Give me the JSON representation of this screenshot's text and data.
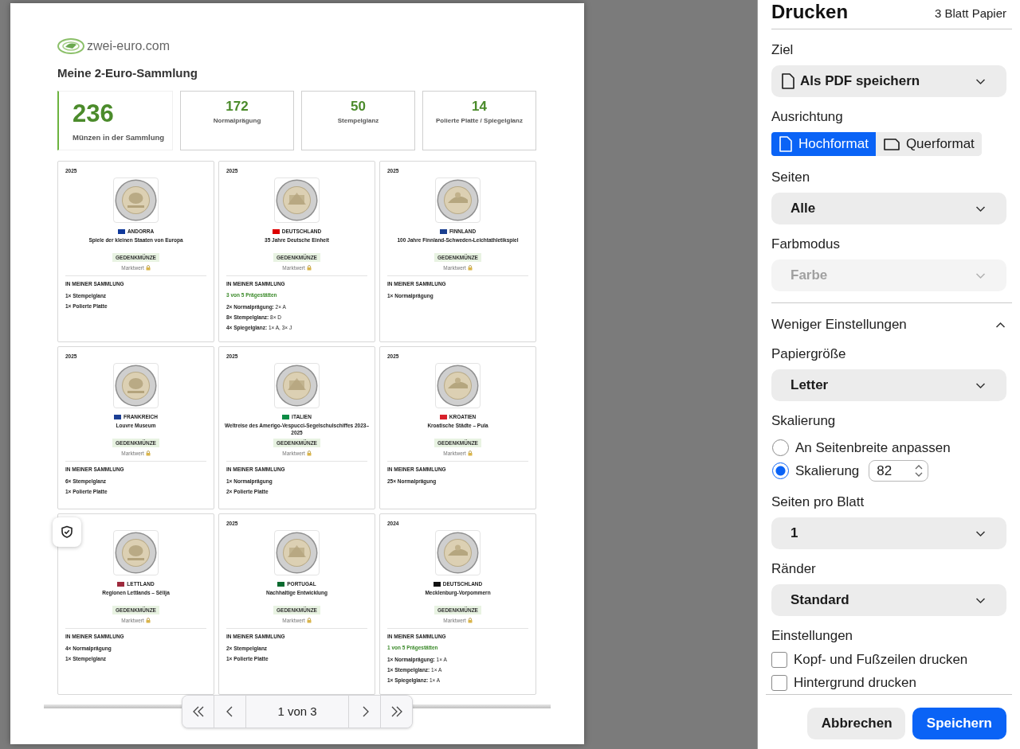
{
  "preview": {
    "logo_text": "zwei-euro.com",
    "heading": "Meine 2-Euro-Sammlung",
    "stats": [
      {
        "value": "236",
        "label": "Münzen in der Sammlung",
        "highlighted": true
      },
      {
        "value": "172",
        "label": "Normalprägung",
        "highlighted": false
      },
      {
        "value": "50",
        "label": "Stempelglanz",
        "highlighted": false
      },
      {
        "value": "14",
        "label": "Polierte Platte / Spiegelglanz",
        "highlighted": false
      }
    ],
    "coin_rows": [
      [
        {
          "year": "2025",
          "country": "ANDORRA",
          "color": "#10399b",
          "title": "Spiele der kleinen Staaten von Europa",
          "tag": "GEDENKMÜNZE",
          "price_label": "Marktwert",
          "section": "IN MEINER SAMMLUNG",
          "entries": [
            {
              "label": "1× Stempelglanz"
            },
            {
              "label": "1× Polierte Platte"
            }
          ]
        },
        {
          "year": "2025",
          "country": "DEUTSCHLAND",
          "color": "#dd0000",
          "title": "35 Jahre Deutsche Einheit",
          "tag": "GEDENKMÜNZE",
          "price_label": "Marktwert",
          "section": "IN MEINER SAMMLUNG",
          "mints": "3 von 5 Prägestätten",
          "entries": [
            {
              "label": "2× Normalprägung:",
              "detail": "2× A"
            },
            {
              "label": "8× Stempelglanz:",
              "detail": "8× D"
            },
            {
              "label": "4× Spiegelglanz:",
              "detail": "1× A, 3× J"
            }
          ]
        },
        {
          "year": "2025",
          "country": "FINNLAND",
          "color": "#1a3f8f",
          "title": "100 Jahre Finnland-Schweden-Leichtathletikspiel",
          "tag": "GEDENKMÜNZE",
          "price_label": "Marktwert",
          "section": "IN MEINER SAMMLUNG",
          "entries": [
            {
              "label": "1× Normalprägung"
            }
          ]
        }
      ],
      [
        {
          "year": "2025",
          "country": "FRANKREICH",
          "color": "#1c3f94",
          "title": "Louvre Museum",
          "tag": "GEDENKMÜNZE",
          "price_label": "Marktwert",
          "section": "IN MEINER SAMMLUNG",
          "entries": [
            {
              "label": "6× Stempelglanz"
            },
            {
              "label": "1× Polierte Platte"
            }
          ]
        },
        {
          "year": "2025",
          "country": "ITALIEN",
          "color": "#0c8c45",
          "title": "Weltreise des Amerigo-Vespucci-Segelschulschiffes 2023–2025",
          "tag": "GEDENKMÜNZE",
          "price_label": "Marktwert",
          "section": "IN MEINER SAMMLUNG",
          "entries": [
            {
              "label": "1× Normalprägung"
            },
            {
              "label": "2× Polierte Platte"
            }
          ]
        },
        {
          "year": "2025",
          "country": "KROATIEN",
          "color": "#d8202b",
          "title": "Kroatische Städte – Pula",
          "tag": "GEDENKMÜNZE",
          "price_label": "Marktwert",
          "section": "IN MEINER SAMMLUNG",
          "entries": [
            {
              "label": "25× Normalprägung"
            }
          ]
        }
      ],
      [
        {
          "country": "LETTLAND",
          "color": "#9e2a3c",
          "title": "Regionen Lettlands – Sēlija",
          "tag": "GEDENKMÜNZE",
          "price_label": "Marktwert",
          "section": "IN MEINER SAMMLUNG",
          "entries": [
            {
              "label": "4× Normalprägung"
            },
            {
              "label": "1× Stempelglanz"
            }
          ]
        },
        {
          "year": "2025",
          "country": "PORTUGAL",
          "color": "#0a6a2f",
          "title": "Nachhaltige Entwicklung",
          "tag": "GEDENKMÜNZE",
          "price_label": "Marktwert",
          "section": "IN MEINER SAMMLUNG",
          "entries": [
            {
              "label": "2× Stempelglanz"
            },
            {
              "label": "1× Polierte Platte"
            }
          ]
        },
        {
          "year": "2024",
          "country": "DEUTSCHLAND",
          "color": "#111111",
          "title": "Mecklenburg-Vorpommern",
          "tag": "GEDENKMÜNZE",
          "price_label": "Marktwert",
          "section": "IN MEINER SAMMLUNG",
          "mints": "1 von 5 Prägestätten",
          "entries": [
            {
              "label": "1× Normalprägung:",
              "detail": "1× A"
            },
            {
              "label": "1× Stempelglanz:",
              "detail": "1× A"
            },
            {
              "label": "1× Spiegelglanz:",
              "detail": "1× A"
            }
          ]
        }
      ]
    ],
    "pager": {
      "page_label": "1 von 3"
    }
  },
  "print_panel": {
    "title": "Drucken",
    "sheets": "3 Blatt Papier",
    "basic": [
      {
        "kind": "destination",
        "label": "Ziel",
        "value": "Als PDF speichern",
        "disabled": false
      },
      {
        "kind": "segmented",
        "label": "Ausrichtung",
        "options": [
          {
            "text": "Hochformat",
            "selected": true
          },
          {
            "text": "Querformat",
            "selected": false
          }
        ]
      },
      {
        "kind": "select",
        "label": "Seiten",
        "value": "Alle",
        "disabled": false
      },
      {
        "kind": "select",
        "label": "Farbmodus",
        "value": "Farbe",
        "disabled": true
      }
    ],
    "toggle": {
      "text": "Weniger Einstellungen",
      "expanded": true
    },
    "advanced": [
      {
        "kind": "select",
        "label": "Papiergröße",
        "value": "Letter",
        "disabled": false
      },
      {
        "kind": "radio",
        "label": "Skalierung",
        "options": [
          {
            "text": "An Seitenbreite anpassen",
            "selected": false
          },
          {
            "text": "Skalierung",
            "selected": true,
            "value": "82"
          }
        ]
      },
      {
        "kind": "select",
        "label": "Seiten pro Blatt",
        "value": "1",
        "disabled": false
      },
      {
        "kind": "select",
        "label": "Ränder",
        "value": "Standard",
        "disabled": false
      },
      {
        "kind": "checkboxes",
        "label": "Einstellungen",
        "options": [
          {
            "text": "Kopf- und Fußzeilen drucken",
            "checked": false
          },
          {
            "text": "Hintergrund drucken",
            "checked": false
          }
        ]
      }
    ],
    "buttons": [
      {
        "text": "Abbrechen",
        "primary": false
      },
      {
        "text": "Speichern",
        "primary": true
      }
    ]
  }
}
